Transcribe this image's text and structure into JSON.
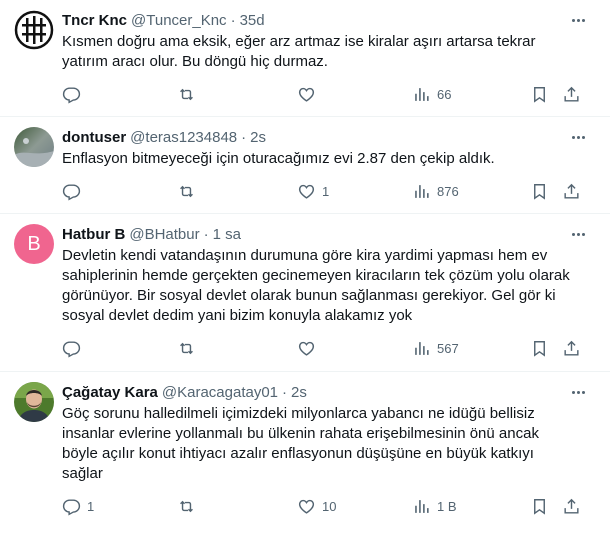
{
  "tweets": [
    {
      "name": "Tncr Knc",
      "handle": "@Tuncer_Knc",
      "separator": "·",
      "time": "35d",
      "text": "Kısmen doğru ama eksik, eğer arz artmaz ise kiralar aşırı artarsa tekrar yatırım aracı olur. Bu döngü hiç durmaz.",
      "replies": "",
      "retweets": "",
      "likes": "",
      "views": "66"
    },
    {
      "name": "dontuser",
      "handle": "@teras1234848",
      "separator": "·",
      "time": "2s",
      "text": "Enflasyon bitmeyeceği için oturacağımız evi 2.87 den çekip aldık.",
      "replies": "",
      "retweets": "",
      "likes": "1",
      "views": "876"
    },
    {
      "name": "Hatbur B",
      "handle": "@BHatbur",
      "separator": "·",
      "time": "1 sa",
      "avatar_letter": "B",
      "avatar_color": "#f0658f",
      "text": "Devletin kendi vatandaşının durumuna göre kira yardimi yapması hem ev sahiplerinin hemde gerçekten gecinemeyen kiracıların tek çözüm yolu olarak görünüyor. Bir sosyal devlet olarak bunun sağlanması gerekiyor. Gel gör ki sosyal devlet dedim yani bizim konuyla alakamız yok",
      "replies": "",
      "retweets": "",
      "likes": "",
      "views": "567"
    },
    {
      "name": "Çağatay Kara",
      "handle": "@Karacagatay01",
      "separator": "·",
      "time": "2s",
      "text": "Göç sorunu halledilmeli içimizdeki milyonlarca yabancı ne idüğü bellisiz insanlar evlerine yollanmalı bu ülkenin rahata erişebilmesinin önü ancak böyle açılır konut ihtiyacı azalır enflasyonun düşüşüne en büyük katkıyı sağlar",
      "replies": "1",
      "retweets": "",
      "likes": "10",
      "views": "1 B"
    }
  ],
  "icons": {
    "more": "more-horizontal-icon",
    "reply": "reply-icon",
    "retweet": "retweet-icon",
    "like": "heart-icon",
    "views": "views-chart-icon",
    "bookmark": "bookmark-icon",
    "share": "share-icon"
  },
  "colors": {
    "text": "#0f1419",
    "secondary": "#536471",
    "divider": "#eff3f4"
  }
}
